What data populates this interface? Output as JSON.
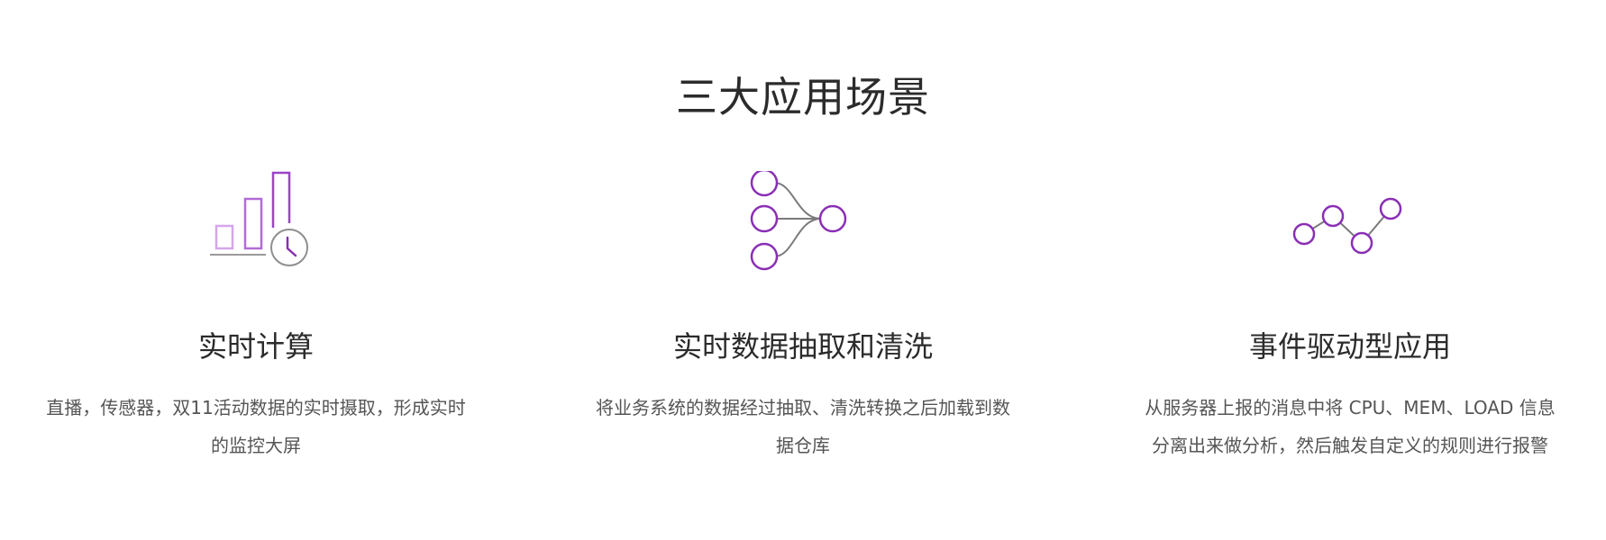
{
  "section": {
    "title": "三大应用场景"
  },
  "colors": {
    "accent": "#8a2fb5",
    "accent_light": "#c58be0",
    "line": "#7a7a7a"
  },
  "scenarios": [
    {
      "icon": "realtime-bar-chart-clock-icon",
      "title": "实时计算",
      "desc_line1": "直播，传感器，双11活动数据的实时摄取，形成实时",
      "desc_line2": "的监控大屏"
    },
    {
      "icon": "data-pipeline-nodes-icon",
      "title": "实时数据抽取和清洗",
      "desc_line1": "将业务系统的数据经过抽取、清洗转换之后加载到数",
      "desc_line2": "据仓库"
    },
    {
      "icon": "event-line-chart-icon",
      "title": "事件驱动型应用",
      "desc_line1": "从服务器上报的消息中将 CPU、MEM、LOAD 信息",
      "desc_line2": "分离出来做分析，然后触发自定义的规则进行报警"
    }
  ]
}
